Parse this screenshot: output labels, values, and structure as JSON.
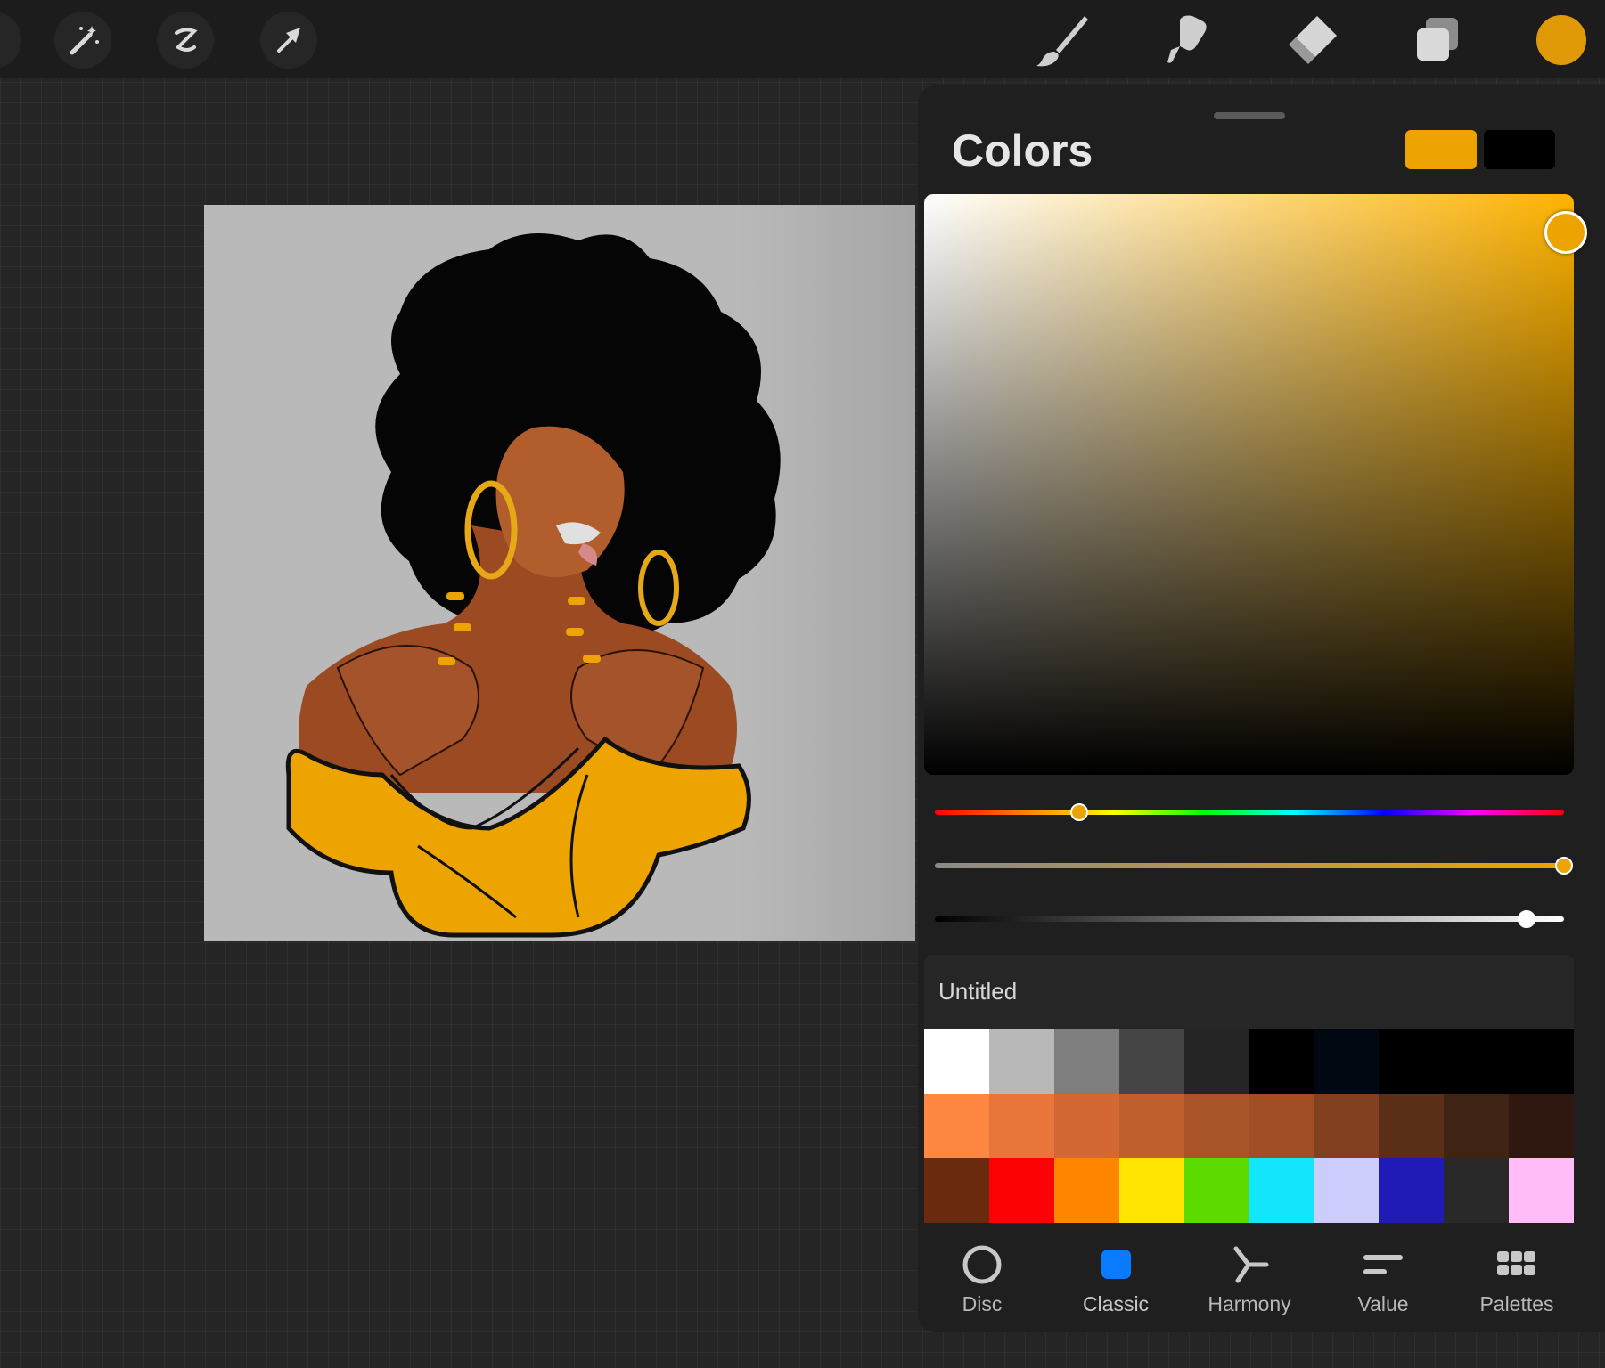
{
  "app": {
    "accent_color": "#E19A07"
  },
  "toolbar": {
    "left_tools": [
      {
        "icon": "magic-wand-icon"
      },
      {
        "icon": "selection-icon"
      },
      {
        "icon": "transform-arrow-icon"
      }
    ],
    "right_tools": [
      {
        "icon": "brush-icon"
      },
      {
        "icon": "smudge-icon"
      },
      {
        "icon": "eraser-icon"
      },
      {
        "icon": "layers-icon"
      }
    ],
    "current_color": "#E19A07"
  },
  "colors_panel": {
    "title": "Colors",
    "primary_color": "#EEA400",
    "secondary_color": "#000000",
    "hue_value": 0.23,
    "saturation_value": 1.0,
    "brightness_value": 0.94,
    "palette": {
      "name": "Untitled",
      "swatches": [
        "#ffffff",
        "#b8b8b8",
        "#7e7e7e",
        "#454545",
        "#252525",
        "#000000",
        "#020812",
        "#000000",
        "#000000",
        "#000000",
        "#FE8841",
        "#E8763B",
        "#D46835",
        "#BF5F2E",
        "#A85428",
        "#A24E24",
        "#83401E",
        "#5A2E17",
        "#3F2314",
        "#2E180F",
        "#6A2A0D",
        "#FD0205",
        "#FD8500",
        "#FFE502",
        "#5BDB00",
        "#13E6FC",
        "#CDCDFD",
        "#201AB6",
        "#292929",
        "#FFBCF6"
      ]
    },
    "tabs": [
      {
        "label": "Disc",
        "icon": "disc-icon",
        "active": false
      },
      {
        "label": "Classic",
        "icon": "classic-square-icon",
        "active": true
      },
      {
        "label": "Harmony",
        "icon": "harmony-icon",
        "active": false
      },
      {
        "label": "Value",
        "icon": "value-sliders-icon",
        "active": false
      },
      {
        "label": "Palettes",
        "icon": "palettes-grid-icon",
        "active": false
      }
    ]
  }
}
